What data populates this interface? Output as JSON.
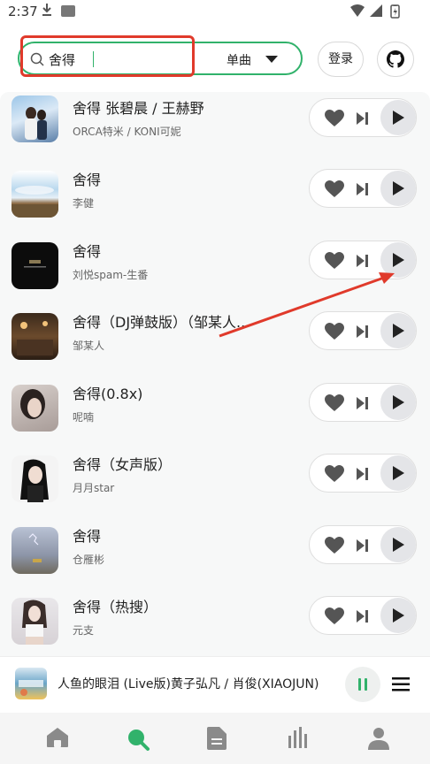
{
  "status": {
    "time": "2:37"
  },
  "search": {
    "query": "舍得",
    "type_label": "单曲"
  },
  "header": {
    "login_label": "登录"
  },
  "songs": [
    {
      "title": "舍得 张碧晨 / 王赫野",
      "artist": "ORCA特米 / KONI可妮"
    },
    {
      "title": "舍得",
      "artist": "李健"
    },
    {
      "title": "舍得",
      "artist": "刘悦spam-生番"
    },
    {
      "title": "舍得（DJ弹鼓版）（邹某人...",
      "artist": "邹某人"
    },
    {
      "title": "舍得(0.8x)",
      "artist": "呢喃"
    },
    {
      "title": "舍得（女声版）",
      "artist": "月月star"
    },
    {
      "title": "舍得",
      "artist": "仓雁彬"
    },
    {
      "title": "舍得（热搜）",
      "artist": "元支"
    }
  ],
  "player": {
    "now_playing": "人鱼的眼泪 (Live版)黄子弘凡 / 肖俊(XIAOJUN)"
  },
  "colors": {
    "accent": "#31b26b",
    "annotation": "#e03a2b"
  },
  "nav": [
    "home-icon",
    "search-icon",
    "document-icon",
    "chart-icon",
    "user-icon"
  ]
}
